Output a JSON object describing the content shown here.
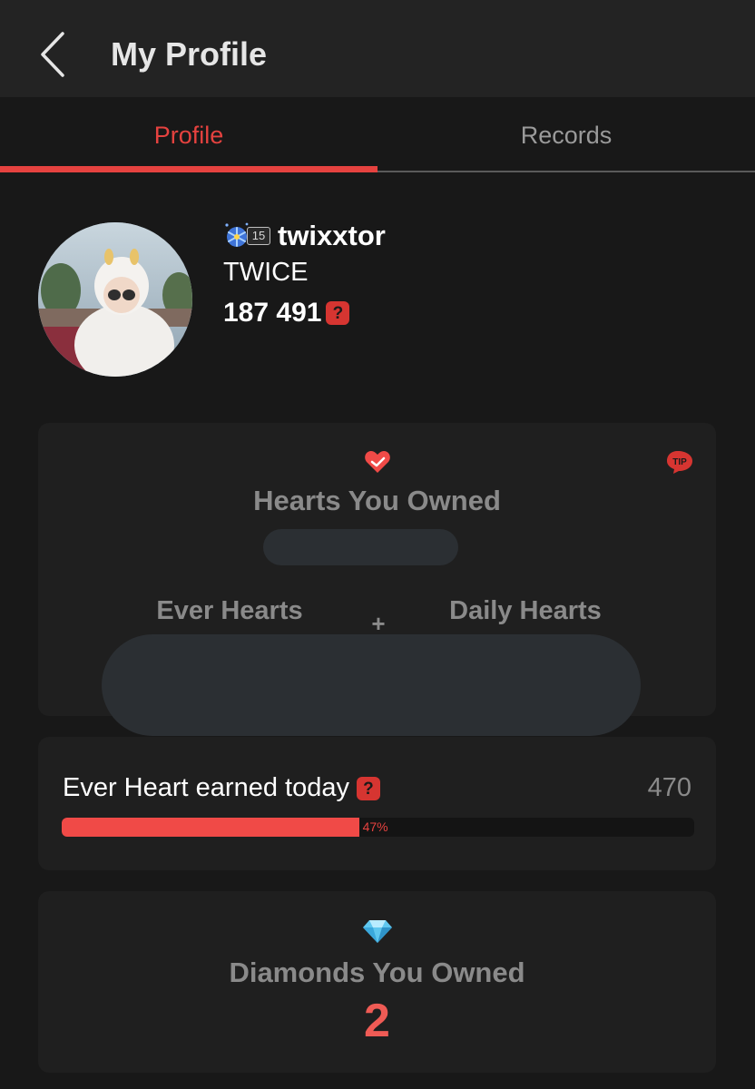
{
  "header": {
    "back_icon": "chevron-left-icon",
    "title": "My Profile"
  },
  "tabs": [
    {
      "label": "Profile",
      "active": true
    },
    {
      "label": "Records",
      "active": false
    }
  ],
  "profile": {
    "badge_level": "15",
    "username": "twixxtor",
    "group": "TWICE",
    "points": "187 491"
  },
  "hearts_card": {
    "title": "Hearts You Owned",
    "tip_label": "TIP",
    "ever_label": "Ever Hearts",
    "plus": "+",
    "daily_label": "Daily Hearts"
  },
  "ever_heart_today": {
    "title": "Ever Heart earned today",
    "value": "470",
    "progress_percent": 47,
    "progress_label": "47%"
  },
  "diamonds": {
    "title": "Diamonds You Owned",
    "value": "2"
  },
  "colors": {
    "accent": "#e5423f",
    "background": "#181818",
    "card": "#1f1f1f",
    "redaction": "#2b2f33"
  },
  "help_glyph": "?"
}
